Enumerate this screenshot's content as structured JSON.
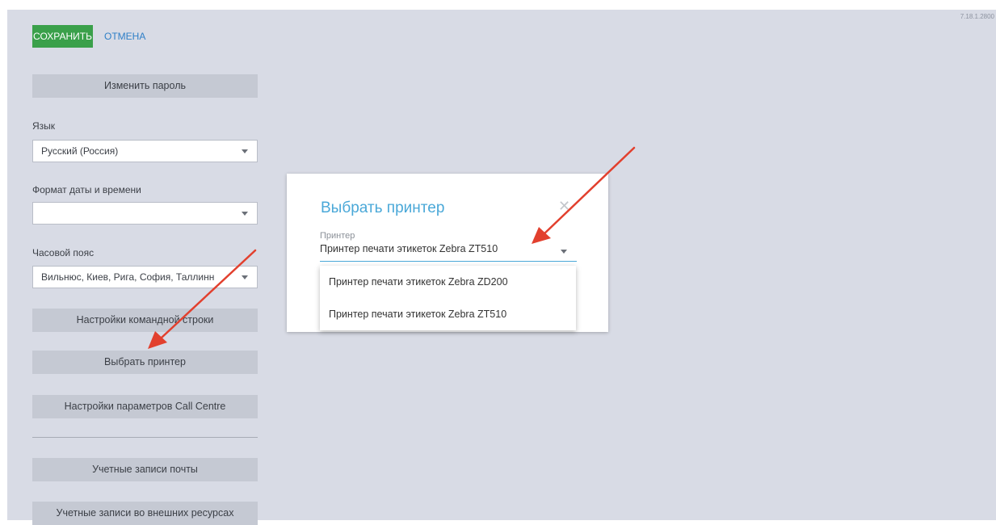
{
  "app": {
    "version": "7.18.1.2800"
  },
  "toolbar": {
    "save_label": "СОХРАНИТЬ",
    "cancel_label": "ОТМЕНА"
  },
  "settings": {
    "change_password": "Изменить пароль",
    "language_label": "Язык",
    "language_value": "Русский (Россия)",
    "datetime_label": "Формат даты и времени",
    "datetime_value": "",
    "timezone_label": "Часовой пояс",
    "timezone_value": "Вильнюс, Киев, Рига, София, Таллинн",
    "command_line": "Настройки командной строки",
    "select_printer": "Выбрать принтер",
    "call_centre": "Настройки параметров Call Centre",
    "mail_accounts": "Учетные записи почты",
    "external_accounts": "Учетные записи во внешних ресурсах"
  },
  "dialog": {
    "title": "Выбрать принтер",
    "close_icon": "close-icon",
    "printer_label": "Принтер",
    "printer_value": "Принтер печати этикеток Zebra ZT510",
    "options": [
      "Принтер печати этикеток Zebra ZD200",
      "Принтер печати этикеток Zebra ZT510"
    ]
  },
  "colors": {
    "save": "#3aa04a",
    "link": "#2f7fc7",
    "dialog_title": "#4aa8d8",
    "arrow": "#e2402e"
  }
}
